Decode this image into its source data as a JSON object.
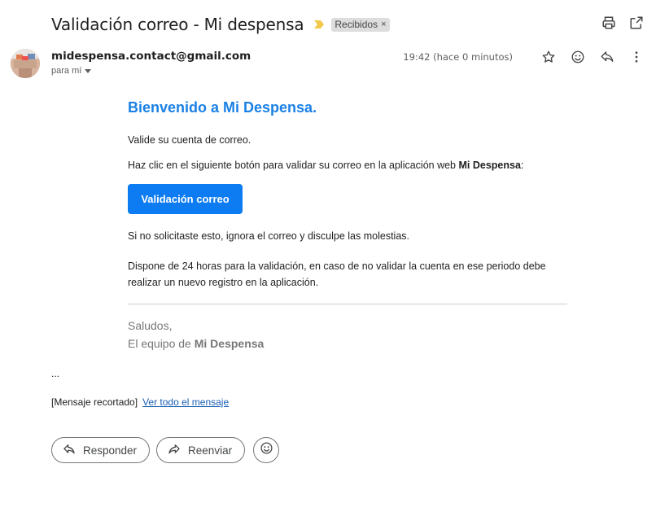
{
  "header": {
    "subject": "Validación correo - Mi despensa",
    "label": "Recibidos",
    "label_close": "×"
  },
  "icons": {
    "print": "print-icon",
    "open_new_window": "open-in-new-window-icon",
    "star": "star-icon",
    "emoji": "emoji-icon",
    "reply": "reply-icon",
    "more": "more-vert-icon",
    "importance": "importance-marker-icon",
    "dropdown": "chevron-down-icon",
    "forward": "forward-icon"
  },
  "message": {
    "sender": "midespensa.contact@gmail.com",
    "recipient": "para mí",
    "timestamp": "19:42 (hace 0 minutos)"
  },
  "body": {
    "welcome": "Bienvenido a Mi Despensa.",
    "line1": "Valide su cuenta de correo.",
    "line2_prefix": "Haz clic en el siguiente botón para validar su correo en la aplicación web ",
    "line2_bold": "Mi Despensa",
    "line2_suffix": ":",
    "cta_label": "Validación correo",
    "line3": "Si no solicitaste esto, ignora el correo y disculpe las molestias.",
    "line4": "Dispone de 24 horas para la validación, en caso de no validar la cuenta en ese periodo debe realizar un nuevo registro en la aplicación.",
    "signoff": "Saludos,",
    "team_prefix": "El equipo de ",
    "team_bold": "Mi Despensa"
  },
  "footer": {
    "ellipsis": "...",
    "clipped_text": "[Mensaje recortado]",
    "view_all": "Ver todo el mensaje"
  },
  "actions": {
    "reply": "Responder",
    "forward": "Reenviar"
  },
  "colors": {
    "accent_blue": "#1a80e5",
    "button_blue": "#0d7cf2",
    "importance_yellow": "#f2c94c",
    "link": "#1a5fb4"
  }
}
